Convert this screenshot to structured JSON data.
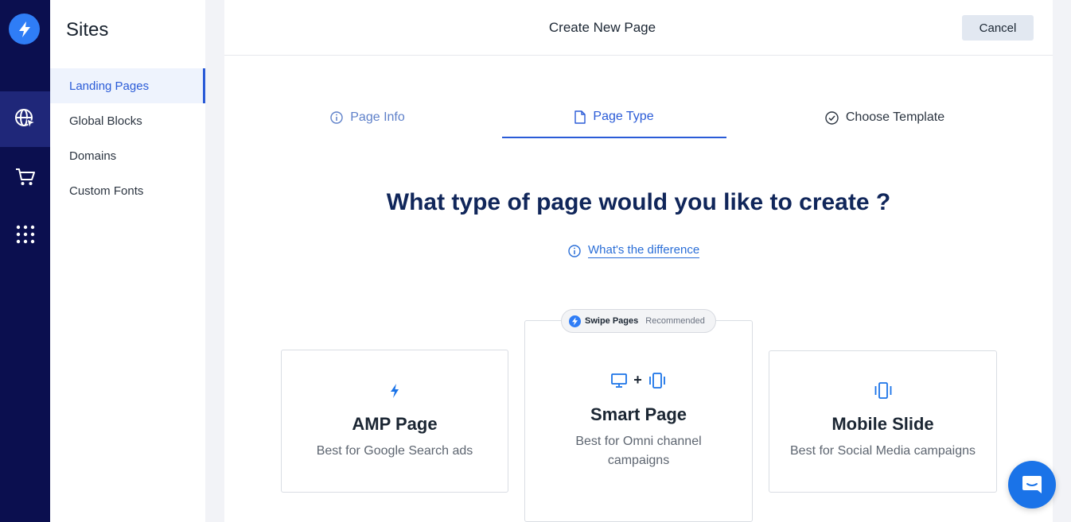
{
  "rail": {
    "logo_icon": "bolt-icon",
    "items": [
      {
        "icon": "globe-cursor-icon",
        "active": true
      },
      {
        "icon": "cart-icon",
        "active": false
      },
      {
        "icon": "grid-dots-icon",
        "active": false
      }
    ]
  },
  "sidebar": {
    "title": "Sites",
    "items": [
      {
        "label": "Landing Pages",
        "active": true
      },
      {
        "label": "Global Blocks",
        "active": false
      },
      {
        "label": "Domains",
        "active": false
      },
      {
        "label": "Custom Fonts",
        "active": false
      }
    ]
  },
  "header": {
    "title": "Create New Page",
    "cancel_label": "Cancel"
  },
  "steps": [
    {
      "label": "Page Info",
      "icon": "info-icon"
    },
    {
      "label": "Page Type",
      "icon": "document-icon"
    },
    {
      "label": "Choose Template",
      "icon": "check-circle-icon"
    }
  ],
  "main": {
    "question": "What type of page would you like to create ?",
    "difference_link": "What's the difference"
  },
  "badge": {
    "brand": "Swipe Pages",
    "label": "Recommended"
  },
  "cards": {
    "amp": {
      "title": "AMP Page",
      "desc": "Best for Google Search ads",
      "icon": "bolt-icon"
    },
    "smart": {
      "title": "Smart Page",
      "desc_line1": "Best for Omni channel",
      "desc_line2": "campaigns",
      "icon": "desktop-plus-mobile-icon",
      "plus": "+"
    },
    "mobile": {
      "title": "Mobile Slide",
      "desc": "Best for Social Media campaigns",
      "icon": "mobile-icon"
    }
  },
  "colors": {
    "rail_bg": "#0b0f4f",
    "accent": "#2a5bd7",
    "brand_blue": "#2f7df6",
    "heading": "#10265a"
  },
  "chat": {
    "icon": "chat-bubble-icon"
  }
}
